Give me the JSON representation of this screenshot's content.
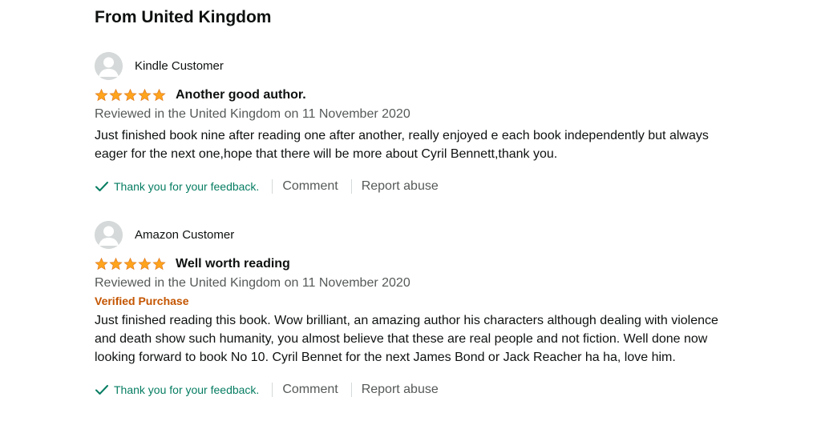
{
  "section": {
    "title": "From United Kingdom"
  },
  "colors": {
    "star": "#ffa41c",
    "verified": "#c45500",
    "feedback": "#067d62",
    "muted_text": "#565959"
  },
  "reviews": [
    {
      "author": "Kindle Customer",
      "rating": 5,
      "title": "Another good author.",
      "date": "Reviewed in the United Kingdom on 11 November 2020",
      "verified": "",
      "body": "Just finished book nine after reading one after another, really enjoyed e each book independently but always eager for the next one,hope that there will be more about Cyril Bennett,thank you.",
      "feedback": "Thank you for your feedback.",
      "comment_label": "Comment",
      "report_label": "Report abuse"
    },
    {
      "author": "Amazon Customer",
      "rating": 5,
      "title": "Well worth reading",
      "date": "Reviewed in the United Kingdom on 11 November 2020",
      "verified": "Verified Purchase",
      "body": "Just finished reading this book. Wow brilliant, an amazing author his characters although dealing with violence and death show such humanity, you almost believe that these are real people and not fiction. Well done now looking forward to book No 10. Cyril Bennet for the next James Bond or Jack Reacher ha ha, love him.",
      "feedback": "Thank you for your feedback.",
      "comment_label": "Comment",
      "report_label": "Report abuse"
    }
  ]
}
